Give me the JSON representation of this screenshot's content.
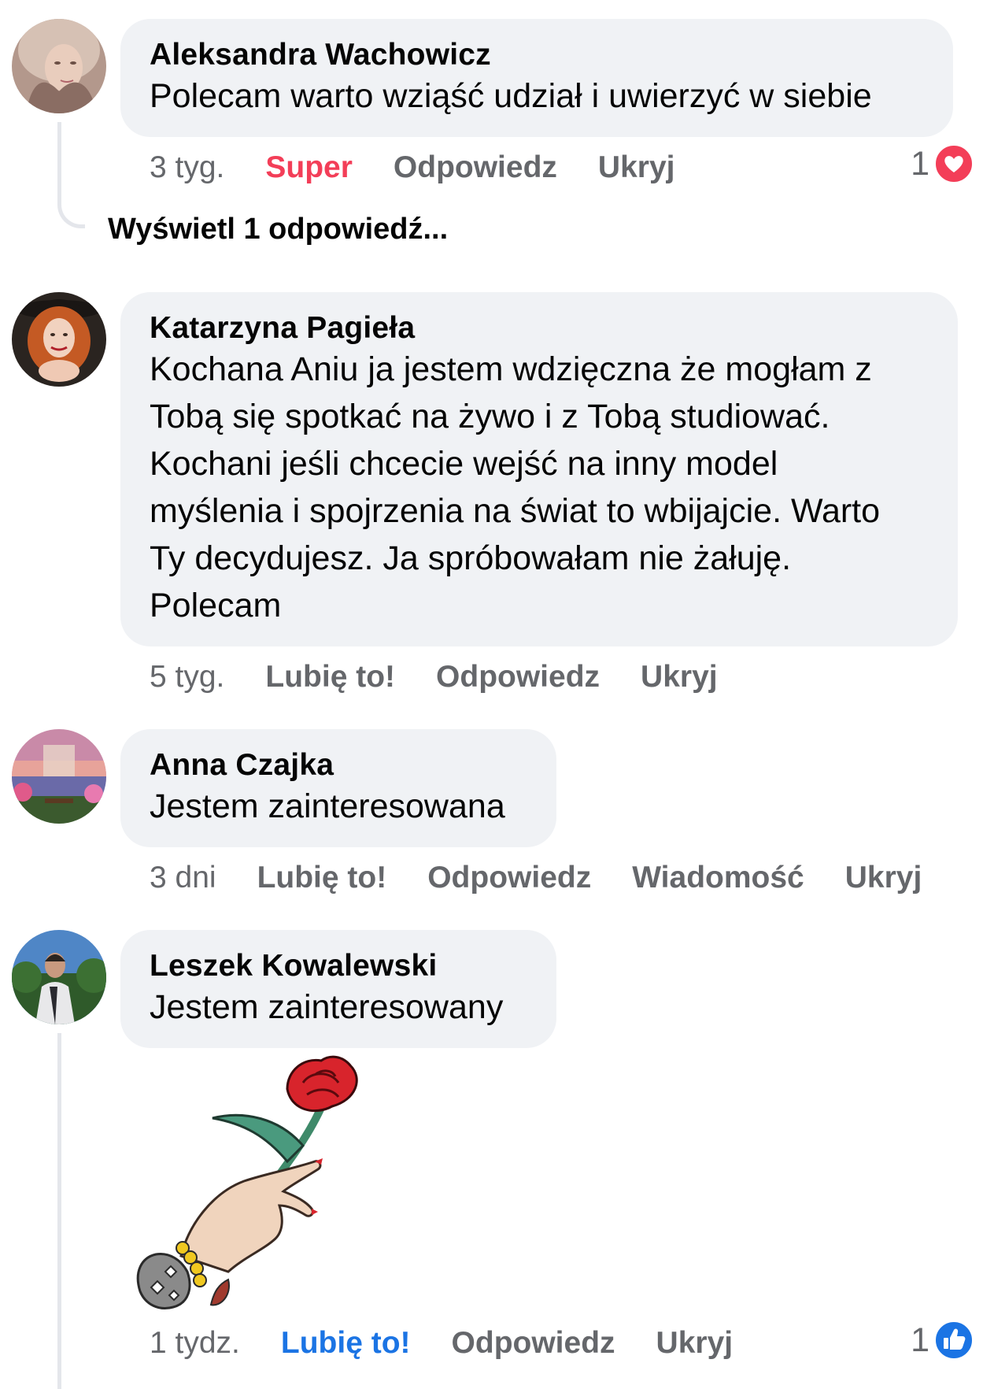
{
  "comments": [
    {
      "author": "Aleksandra Wachowicz",
      "text": "Polecam warto wziąść udział i uwierzyć w siebie",
      "time": "3 tyg.",
      "reaction_action": "Super",
      "reply": "Odpowiedz",
      "hide": "Ukryj",
      "reaction_count": "1",
      "reaction_icon": "heart-icon",
      "view_replies": "Wyświetl 1 odpowiedź..."
    },
    {
      "author": "Katarzyna Pagieła",
      "text": "Kochana Aniu ja jestem wdzięczna że mogłam z\nTobą się spotkać na żywo i z Tobą studiować.\nKochani jeśli chcecie wejść na inny model\nmyślenia i spojrzenia na świat to wbijajcie. Warto\nTy decydujesz. Ja spróbowałam nie żałuję.\nPolecam",
      "time": "5 tyg.",
      "like": "Lubię to!",
      "reply": "Odpowiedz",
      "hide": "Ukryj"
    },
    {
      "author": "Anna Czajka",
      "text": "Jestem zainteresowana",
      "time": "3 dni",
      "like": "Lubię to!",
      "reply": "Odpowiedz",
      "message": "Wiadomość",
      "hide": "Ukryj"
    },
    {
      "author": "Leszek Kowalewski",
      "text": "Jestem zainteresowany",
      "time": "1 tydz.",
      "like": "Lubię to!",
      "reply": "Odpowiedz",
      "hide": "Ukryj",
      "reaction_count": "1",
      "reaction_icon": "thumbs-up-icon",
      "sticker": "hand-holding-rose-sticker"
    }
  ],
  "colors": {
    "bubble": "#f0f2f5",
    "meta_text": "#65676b",
    "super_red": "#f33e58",
    "like_blue": "#1b74e4"
  }
}
